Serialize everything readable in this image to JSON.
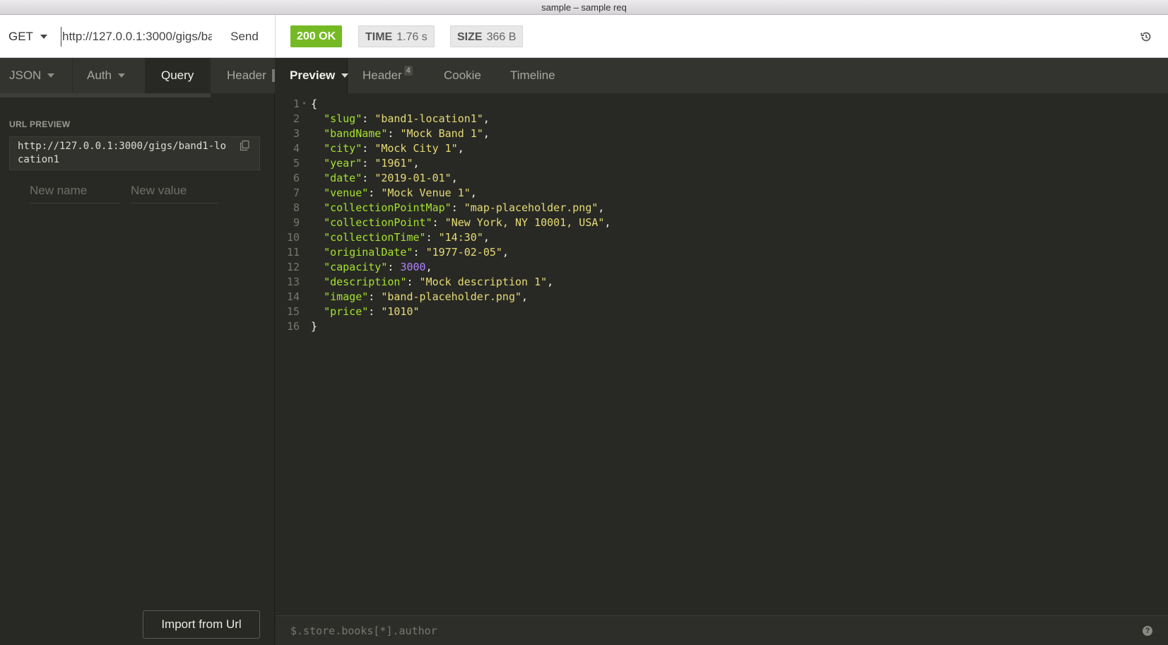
{
  "window": {
    "title": "sample – sample req"
  },
  "request": {
    "method": "GET",
    "url": "http://127.0.0.1:3000/gigs/band1-location1",
    "send_label": "Send"
  },
  "response": {
    "status": "200 OK",
    "status_color": "#75ba24",
    "time_label": "TIME",
    "time_value": "1.76 s",
    "size_label": "SIZE",
    "size_value": "366 B"
  },
  "left_tabs": [
    {
      "label": "JSON",
      "dropdown": true
    },
    {
      "label": "Auth",
      "dropdown": true
    },
    {
      "label": "Query",
      "active": true
    },
    {
      "label": "Header"
    }
  ],
  "query": {
    "url_preview_label": "URL PREVIEW",
    "url_preview": "http://127.0.0.1:3000/gigs/band1-location1",
    "new_name_placeholder": "New name",
    "new_value_placeholder": "New value",
    "import_label": "Import from Url"
  },
  "right_tabs": [
    {
      "label": "Preview",
      "active": true,
      "dropdown": true
    },
    {
      "label": "Header",
      "count": "4"
    },
    {
      "label": "Cookie"
    },
    {
      "label": "Timeline"
    }
  ],
  "response_body": [
    {
      "n": "1",
      "text": "{"
    },
    {
      "n": "2",
      "key": "slug",
      "str": "band1-location1",
      "comma": true
    },
    {
      "n": "3",
      "key": "bandName",
      "str": "Mock Band 1",
      "comma": true
    },
    {
      "n": "4",
      "key": "city",
      "str": "Mock City 1",
      "comma": true
    },
    {
      "n": "5",
      "key": "year",
      "str": "1961",
      "comma": true
    },
    {
      "n": "6",
      "key": "date",
      "str": "2019-01-01",
      "comma": true
    },
    {
      "n": "7",
      "key": "venue",
      "str": "Mock Venue 1",
      "comma": true
    },
    {
      "n": "8",
      "key": "collectionPointMap",
      "str": "map-placeholder.png",
      "comma": true
    },
    {
      "n": "9",
      "key": "collectionPoint",
      "str": "New York, NY 10001, USA",
      "comma": true
    },
    {
      "n": "10",
      "key": "collectionTime",
      "str": "14:30",
      "comma": true
    },
    {
      "n": "11",
      "key": "originalDate",
      "str": "1977-02-05",
      "comma": true
    },
    {
      "n": "12",
      "key": "capacity",
      "num": "3000",
      "comma": true
    },
    {
      "n": "13",
      "key": "description",
      "str": "Mock description 1",
      "comma": true
    },
    {
      "n": "14",
      "key": "image",
      "str": "band-placeholder.png",
      "comma": true
    },
    {
      "n": "15",
      "key": "price",
      "str": "1010",
      "comma": false
    },
    {
      "n": "16",
      "text": "}"
    }
  ],
  "filter": {
    "placeholder": "$.store.books[*].author"
  },
  "icons": {
    "history": "history-icon",
    "copy": "copy-icon",
    "help": "help-icon"
  }
}
